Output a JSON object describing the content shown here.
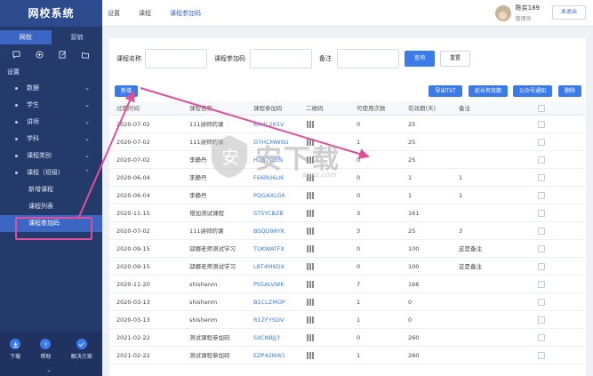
{
  "sidebar": {
    "title": "网校系统",
    "tabs": [
      "网校",
      "营销"
    ],
    "section": "设置",
    "items": [
      {
        "label": "数据"
      },
      {
        "label": "学生"
      },
      {
        "label": "讲师"
      },
      {
        "label": "学科"
      },
      {
        "label": "课程类别"
      },
      {
        "label": "课程（班级）"
      }
    ],
    "subitems": [
      {
        "label": "新增课程"
      },
      {
        "label": "课程列表"
      },
      {
        "label": "课程参加码"
      }
    ],
    "bottom": [
      {
        "label": "下载"
      },
      {
        "label": "帮助"
      },
      {
        "label": "解决方案"
      }
    ]
  },
  "topbar": {
    "breadcrumbs": [
      "设置",
      "课程",
      "课程参加码"
    ],
    "user_name": "陈实189",
    "user_role": "管理员",
    "logout": "本退出"
  },
  "filter": {
    "course_name_label": "课程名称",
    "code_label": "课程参加码",
    "remark_label": "备注",
    "course_name_value": "",
    "code_value": "",
    "remark_value": "",
    "search_button": "查询",
    "reset_button": "重置"
  },
  "actions": {
    "add": "新增",
    "export": "导出TXT",
    "extend": "延长有效期",
    "notify": "公众号通知",
    "delete": "删除"
  },
  "table": {
    "headers": [
      "过期时间",
      "课程名称",
      "课程参加码",
      "二维码",
      "可使用次数",
      "有效期(天)",
      "备注"
    ],
    "rows": [
      {
        "expire": "2020-07-02",
        "course": "111讲师的课",
        "code": "8M4L2K5V",
        "uses": "0",
        "days": "25",
        "remark": ""
      },
      {
        "expire": "2020-07-02",
        "course": "111讲师的课",
        "code": "D7HCMWSU",
        "uses": "1",
        "days": "25",
        "remark": ""
      },
      {
        "expire": "2020-07-02",
        "course": "李静丹",
        "code": "H2B7CJEN",
        "uses": "0",
        "days": "25",
        "remark": ""
      },
      {
        "expire": "2020-06-04",
        "course": "李静丹",
        "code": "F66RU6U6",
        "uses": "0",
        "days": "1",
        "remark": "1"
      },
      {
        "expire": "2020-06-04",
        "course": "李静丹",
        "code": "PQGAXLG6",
        "uses": "0",
        "days": "1",
        "remark": "1"
      },
      {
        "expire": "2020-11-15",
        "course": "增加测试课程",
        "code": "STSYCBZB",
        "uses": "3",
        "days": "161",
        "remark": ""
      },
      {
        "expire": "2020-07-02",
        "course": "111讲师的课",
        "code": "BSQD98YK",
        "uses": "3",
        "days": "25",
        "remark": "3"
      },
      {
        "expire": "2020-09-15",
        "course": "邬娜老师测试学习",
        "code": "TUKWATFX",
        "uses": "0",
        "days": "100",
        "remark": "这是备注"
      },
      {
        "expire": "2020-09-15",
        "course": "邬娜老师测试学习",
        "code": "L8T4M6DX",
        "uses": "0",
        "days": "100",
        "remark": "这是备注"
      },
      {
        "expire": "2020-11-20",
        "course": "shishenm",
        "code": "PS5ALVWK",
        "uses": "7",
        "days": "166",
        "remark": ""
      },
      {
        "expire": "2020-03-13",
        "course": "shishenm",
        "code": "B1CLZMOP",
        "uses": "1",
        "days": "0",
        "remark": ""
      },
      {
        "expire": "2020-03-13",
        "course": "shishenm",
        "code": "R1ZFYSDV",
        "uses": "1",
        "days": "0",
        "remark": ""
      },
      {
        "expire": "2021-02-22",
        "course": "测试课程参加码",
        "code": "SXCNBJJ3",
        "uses": "0",
        "days": "260",
        "remark": ""
      },
      {
        "expire": "2021-02-22",
        "course": "测试课程参加码",
        "code": "EZP42NW1",
        "uses": "1",
        "days": "260",
        "remark": ""
      }
    ]
  },
  "watermark": {
    "text": "安下载",
    "sub": "anxz.com"
  },
  "colors": {
    "sidebar": "#243a6b",
    "accent": "#3b7be8",
    "annotation": "#e0509a"
  }
}
